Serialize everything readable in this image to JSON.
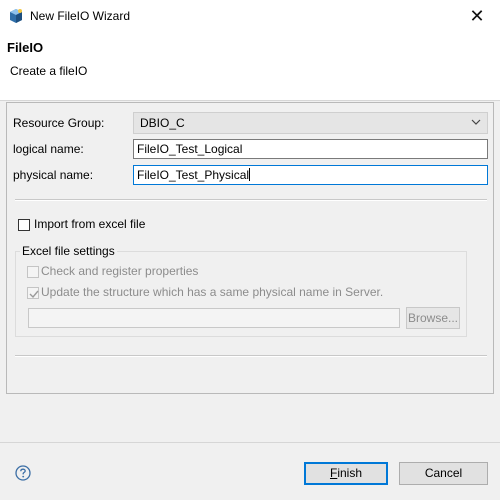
{
  "window": {
    "title": "New FileIO Wizard",
    "close_glyph": "✕",
    "app_icon": "wizard-icon"
  },
  "banner": {
    "title": "FileIO",
    "description": "Create a fileIO"
  },
  "form": {
    "resource_group_label": "Resource Group:",
    "resource_group_value": "DBIO_C",
    "logical_name_label": "logical name:",
    "logical_name_value": "FileIO_Test_Logical",
    "physical_name_label": "physical name:",
    "physical_name_value": "FileIO_Test_Physical"
  },
  "import": {
    "checkbox_label": "Import from excel file",
    "checked": false
  },
  "excel_settings": {
    "group_title": "Excel file settings",
    "check_register_label": "Check and register properties",
    "check_register_checked": false,
    "update_structure_label": "Update the structure which has a same physical name in Server.",
    "update_structure_checked": true,
    "file_path_value": "",
    "browse_label": "Browse..."
  },
  "footer": {
    "finish_mnemonic": "F",
    "finish_rest": "inish",
    "cancel_label": "Cancel",
    "help_icon": "help-icon"
  },
  "colors": {
    "accent": "#0078d7",
    "disabled_text": "#8c8c8c",
    "window_bg": "#f0f0f0"
  }
}
